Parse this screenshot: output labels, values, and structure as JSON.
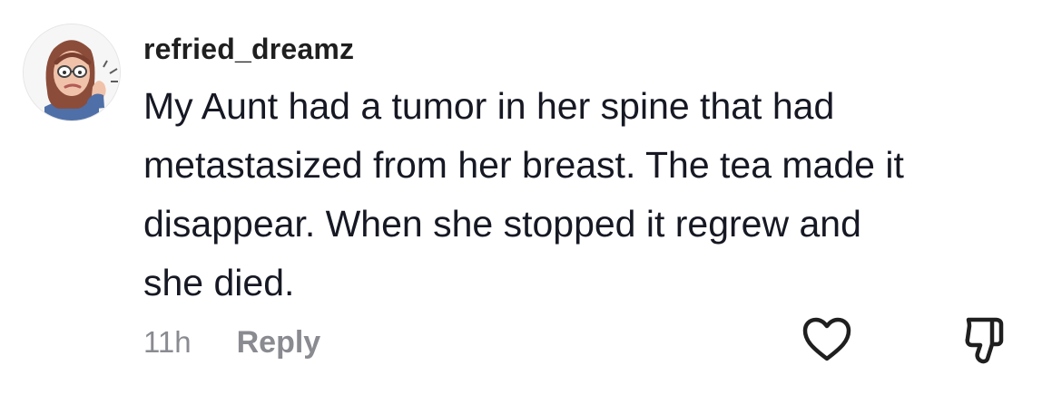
{
  "comment": {
    "username": "refried_dreamz",
    "text_lines": [
      "My Aunt had a tumor in her spine that had",
      "metastasized from her breast. The tea made it",
      "disappear. When she stopped it regrew and",
      "she died."
    ],
    "timestamp": "11h",
    "reply_label": "Reply",
    "avatar_icon": "memoji-avatar-icon",
    "like_icon": "heart-icon",
    "dislike_icon": "thumbs-down-icon"
  },
  "colors": {
    "text": "#161823",
    "muted": "#8a8b91",
    "icon": "#1f1f1f"
  }
}
